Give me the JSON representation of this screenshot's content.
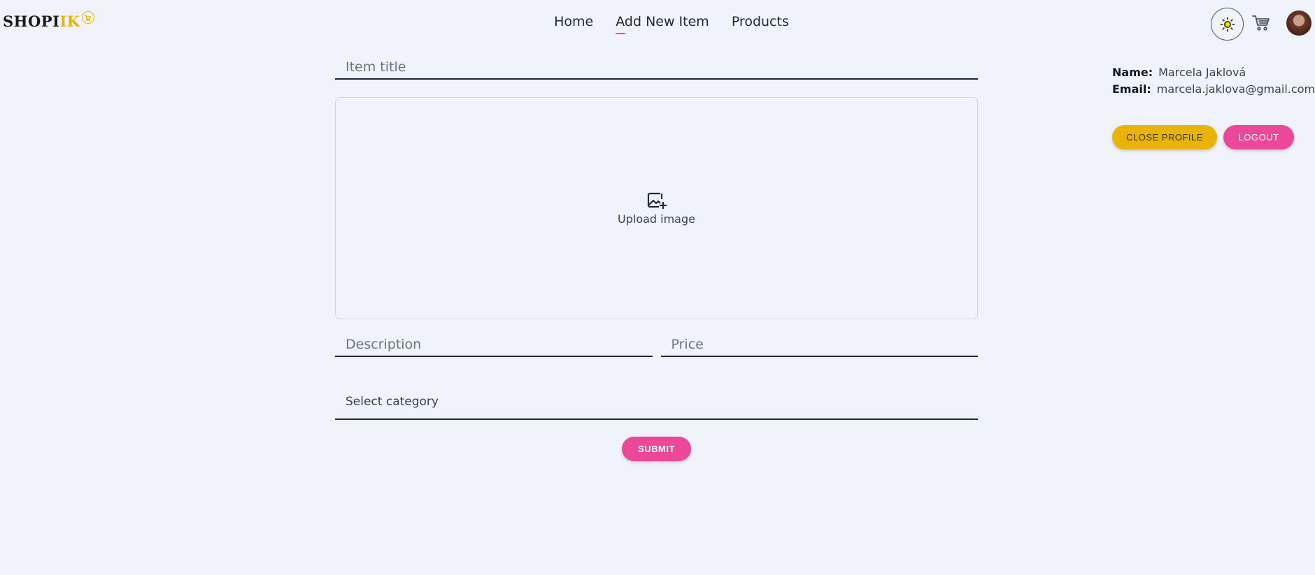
{
  "app": {
    "logo_text_dark": "SHOPI",
    "logo_text_yellow": "IK",
    "logo_badge_icon": "cart-icon",
    "accent_pink": "#ec4899",
    "accent_yellow": "#eab308"
  },
  "nav": {
    "items": [
      {
        "label": "Home",
        "active": false
      },
      {
        "label": "Add New Item",
        "active": true
      },
      {
        "label": "Products",
        "active": false
      }
    ]
  },
  "header_icons": {
    "theme_toggle": "sun-icon",
    "cart": "cart-icon",
    "avatar": "avatar"
  },
  "form": {
    "title_placeholder": "Item title",
    "upload_label": "Upload image",
    "upload_icon": "image-plus-icon",
    "description_placeholder": "Description",
    "price_placeholder": "Price",
    "category_label": "Select category",
    "submit_label": "SUBMIT"
  },
  "profile": {
    "name_key": "Name:",
    "name_value": "Marcela Jaklová",
    "email_key": "Email:",
    "email_value": "marcela.jaklova@gmail.com",
    "close_label": "CLOSE PROFILE",
    "logout_label": "LOGOUT"
  }
}
